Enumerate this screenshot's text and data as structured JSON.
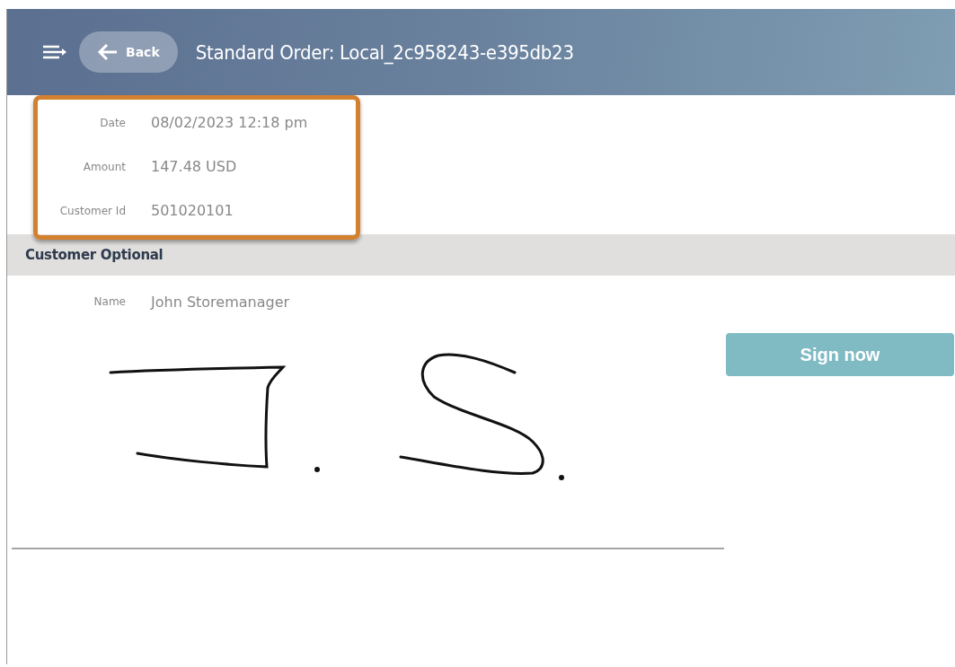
{
  "header": {
    "title": "Standard Order: Local_2c958243-e395db23",
    "back_button": "Back"
  },
  "fields": [
    {
      "label": "Date",
      "value": "08/02/2023 12:18 pm"
    },
    {
      "label": "Amount",
      "value": "147.48 USD"
    },
    {
      "label": "Customer Id",
      "value": "501020101"
    }
  ],
  "section": {
    "title": "Customer Optional",
    "fields": [
      {
        "label": "Name",
        "value": "John Storemanager"
      }
    ]
  },
  "signature": {
    "button": "Sign now"
  }
}
